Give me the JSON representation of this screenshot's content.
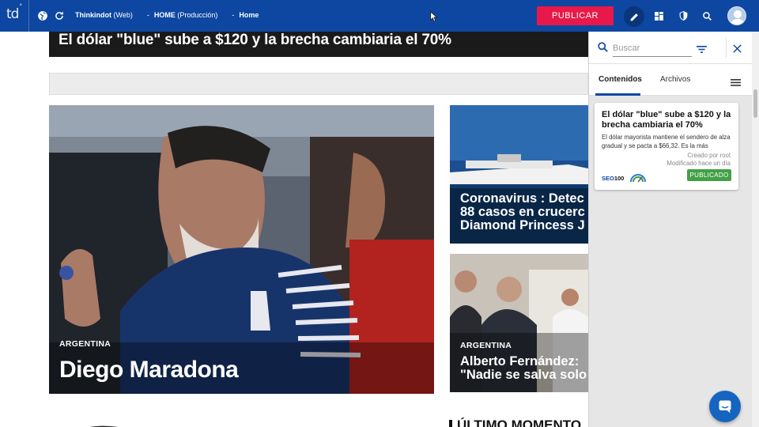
{
  "topbar": {
    "logo": "td",
    "logo_dot": "°",
    "site_name": "Thinkindot",
    "site_suffix": "(Web)",
    "section": "HOME",
    "section_suffix": "(Producción)",
    "page": "Home",
    "publish_label": "PUBLICAR",
    "bg_color": "#0d47a1",
    "publish_color": "#e8194a",
    "icons": [
      "globe-icon",
      "refresh-icon",
      "pencil-icon",
      "layout-grid-icon",
      "shield-icon",
      "search-icon",
      "user-avatar-icon"
    ]
  },
  "page": {
    "top_headline": "El dólar \"blue\" sube a $120 y la brecha cambiaria el 70%",
    "hero": {
      "tag": "ARGENTINA",
      "title": "Diego Maradona"
    },
    "card_top": {
      "title_line1": "Coronavirus : Detec",
      "title_line2": "88 casos en crucerc",
      "title_line3": "Diamond Princess J"
    },
    "card_bottom": {
      "tag": "ARGENTINA",
      "title_line1": "Alberto Fernández:",
      "title_line2": "\"Nadie se salva solo"
    },
    "section_heading": "ÚLTIMO MOMENTO"
  },
  "panel": {
    "search_placeholder": "Buscar",
    "tabs": [
      {
        "label": "Contenidos",
        "active": true
      },
      {
        "label": "Archivos",
        "active": false
      }
    ],
    "article": {
      "title": "El dólar \"blue\" sube a $120 y la brecha cambiaria el 70%",
      "excerpt": "El dólar mayorista mantiene el sendero de alza gradual y se pacta a $66,32. Es la más",
      "created": "Creado por root",
      "modified": "Modificado hace un día",
      "seo_label": "SEO",
      "seo_score": "100",
      "status": "PUBLICADO",
      "status_color": "#43a047"
    }
  }
}
